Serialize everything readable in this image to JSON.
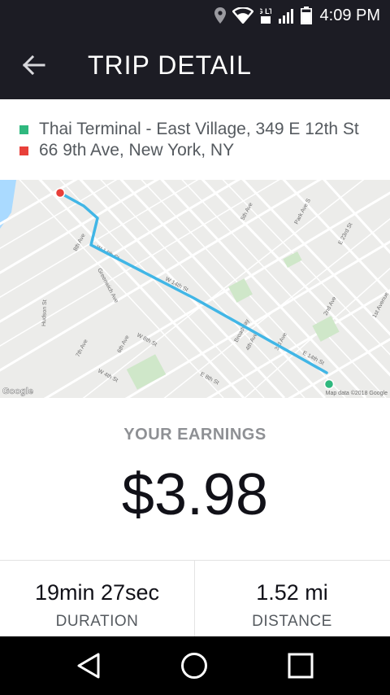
{
  "status_bar": {
    "time": "4:09 PM",
    "network": "4G LTE",
    "icons": [
      "location-icon",
      "wifi-icon",
      "signal-icon",
      "battery-icon"
    ]
  },
  "header": {
    "title": "TRIP DETAIL",
    "back_icon": "back-arrow-icon"
  },
  "trip": {
    "pickup": "Thai Terminal - East Village, 349 E 12th St",
    "dropoff": "66 9th Ave, New York, NY",
    "pickup_color": "#2fb87e",
    "dropoff_color": "#e8403a"
  },
  "map": {
    "logo": "Google",
    "attribution": "Map data ©2018 Google",
    "route_color": "#41b6e6",
    "street_labels": [
      "W 14th St",
      "W 14th St",
      "E 14th St",
      "E 8th St",
      "W 8th St",
      "E 23rd St",
      "Greenwich Ave",
      "7th Ave",
      "6th Ave",
      "Broadway",
      "3rd Ave",
      "2nd Ave",
      "1st Avenue",
      "Hudson St",
      "8th Ave",
      "Park Ave S",
      "5th Ave",
      "4th Ave",
      "W 4th St"
    ]
  },
  "earnings": {
    "label": "YOUR EARNINGS",
    "amount": "$3.98"
  },
  "stats": {
    "duration_value": "19min 27sec",
    "duration_label": "DURATION",
    "distance_value": "1.52 mi",
    "distance_label": "DISTANCE"
  },
  "nav": {
    "icons": [
      "back-triangle-icon",
      "home-circle-icon",
      "recents-square-icon"
    ]
  }
}
